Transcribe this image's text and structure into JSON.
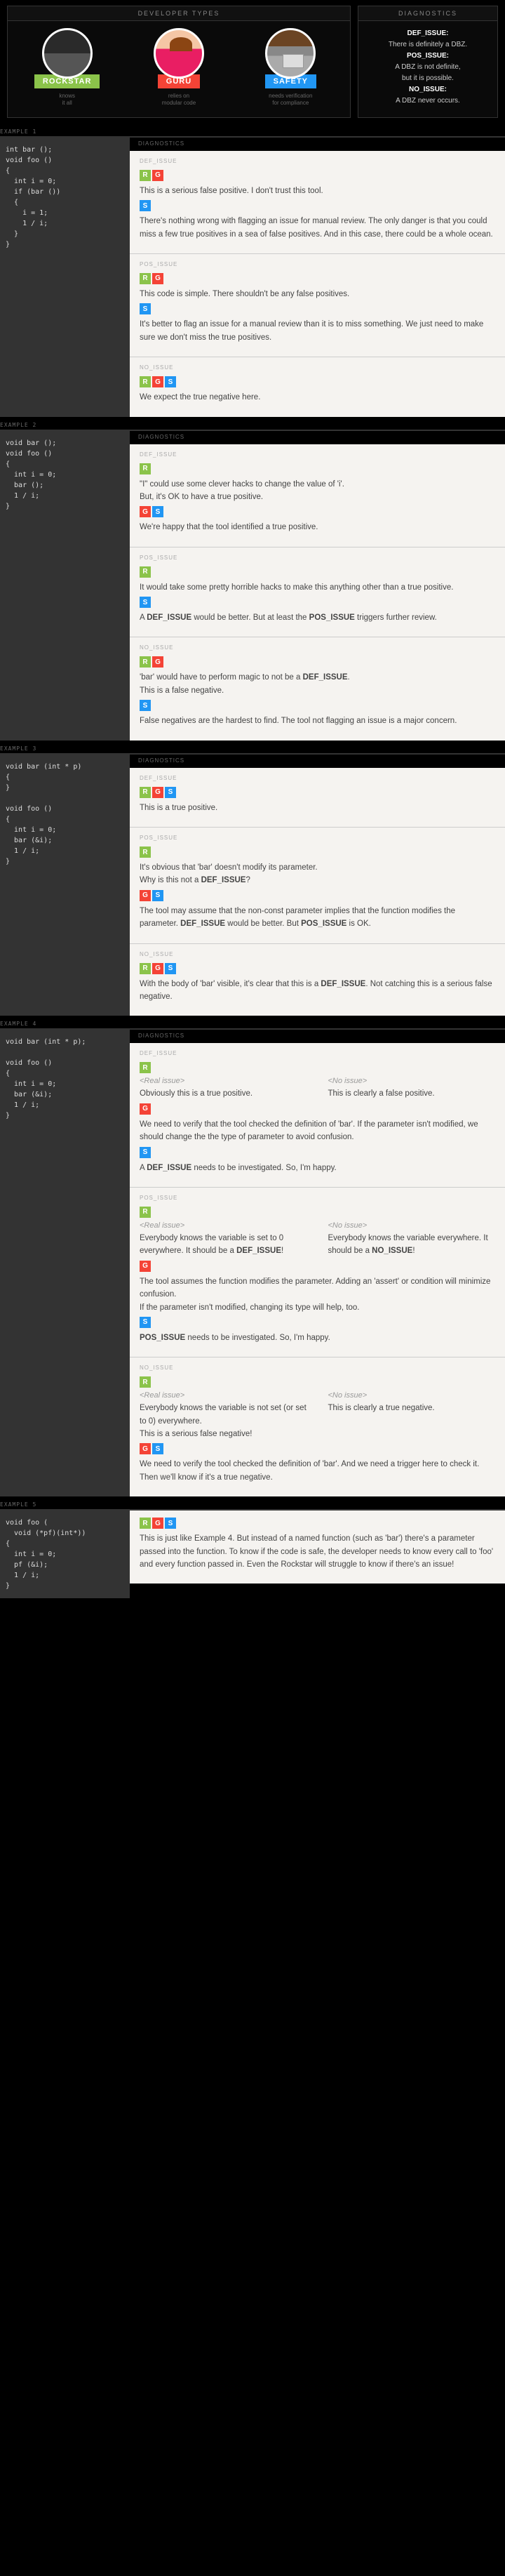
{
  "header": {
    "devtypes": "DEVELOPER TYPES",
    "diagnostics": "DIAGNOSTICS",
    "devs": {
      "rock": {
        "name": "ROCKSTAR",
        "sub": "knows\nit all"
      },
      "guru": {
        "name": "GURU",
        "sub": "relies on\nmodular code"
      },
      "safe": {
        "name": "SAFETY",
        "sub": "needs verification\nfor compliance"
      }
    },
    "defs": {
      "def_t": "DEF_ISSUE:",
      "def_d": "There is definitely a DBZ.",
      "pos_t": "POS_ISSUE:",
      "pos_d": "A DBZ is not definite,\nbut it is possible.",
      "no_t": "NO_ISSUE:",
      "no_d": "A DBZ never occurs."
    }
  },
  "ex1": {
    "label": "EXAMPLE 1",
    "code": "int bar ();\nvoid foo ()\n{\n  int i = 0;\n  if (bar ())\n  {\n    i = 1;\n    1 / i;\n  }\n}",
    "def": {
      "t": "DEF_ISSUE",
      "rg": "This is a serious false positive. I don't trust this tool.",
      "s": "There's nothing wrong with flagging an issue for manual review. The only danger is that you could miss a few true positives in a sea of false positives. And in this case, there could be a whole ocean."
    },
    "pos": {
      "t": "POS_ISSUE",
      "rg": "This code is simple. There shouldn't be any false positives.",
      "s": "It's better to flag an issue for a manual review than it is to miss something. We just need to make sure we don't miss the true positives."
    },
    "no": {
      "t": "NO_ISSUE",
      "all": "We expect the true negative here."
    }
  },
  "ex2": {
    "label": "EXAMPLE 2",
    "code": "void bar ();\nvoid foo ()\n{\n  int i = 0;\n  bar ();\n  1 / i;\n}",
    "def": {
      "t": "DEF_ISSUE",
      "r": "\"I\" could use some clever hacks to change the value of 'i'.\nBut, it's OK to have a true positive.",
      "gs": "We're happy that the tool identified a true positive."
    },
    "pos": {
      "t": "POS_ISSUE",
      "r": "It would take some pretty horrible hacks to make this anything other than a true positive.",
      "s": "A DEF_ISSUE would be better. But at least the POS_ISSUE triggers further review."
    },
    "no": {
      "t": "NO_ISSUE",
      "rg": "'bar' would have to perform magic to not be a DEF_ISSUE.\nThis is a false negative.",
      "s": "False negatives are the hardest to find. The tool not flagging an issue is a major concern."
    }
  },
  "ex3": {
    "label": "EXAMPLE 3",
    "code": "void bar (int * p)\n{\n}\n\nvoid foo ()\n{\n  int i = 0;\n  bar (&i);\n  1 / i;\n}",
    "def": {
      "t": "DEF_ISSUE",
      "all": "This is a true positive."
    },
    "pos": {
      "t": "POS_ISSUE",
      "r": "It's obvious that 'bar' doesn't modify its parameter.\nWhy is this not a DEF_ISSUE?",
      "gs": "The tool may assume that the non-const parameter implies that the function modifies the parameter. DEF_ISSUE would be better. But POS_ISSUE is OK."
    },
    "no": {
      "t": "NO_ISSUE",
      "all": "With the body of 'bar' visible, it's clear that this is a DEF_ISSUE.  Not catching this is a serious false negative."
    }
  },
  "ex4": {
    "label": "EXAMPLE 4",
    "code": "void bar (int * p);\n\nvoid foo ()\n{\n  int i = 0;\n  bar (&i);\n  1 / i;\n}",
    "def": {
      "t": "DEF_ISSUE",
      "real": "<Real issue>",
      "none": "<No issue>",
      "r_real": "Obviously this is a true positive.",
      "r_none": "This is clearly a false positive.",
      "g": "We need to verify that the tool checked the definition of 'bar'.  If the parameter isn't modified, we should change the the type of parameter to avoid confusion.",
      "s": "A DEF_ISSUE needs to be investigated. So, I'm happy."
    },
    "pos": {
      "t": "POS_ISSUE",
      "r_real": "Everybody knows the variable is set to 0 everywhere. It should be a DEF_ISSUE!",
      "r_none": "Everybody knows the variable everywhere. It should be a  NO_ISSUE!",
      "g": "The tool assumes the function modifies the parameter. Adding an 'assert' or condition will minimize confusion.\nIf the parameter isn't modified, changing its type will help, too.",
      "s": "POS_ISSUE needs to be investigated. So, I'm happy."
    },
    "no": {
      "t": "NO_ISSUE",
      "r_real": "Everybody knows the variable is not set (or set to 0) everywhere.\nThis is a serious false negative!",
      "r_none": "This is clearly a true negative.",
      "gs": "We need to verify the tool checked the definition of 'bar'. And we need a trigger here to check it. Then we'll know if it's a true negative."
    }
  },
  "ex5": {
    "label": "EXAMPLE 5",
    "code": "void foo (\n  void (*pf)(int*))\n{\n  int i = 0;\n  pf (&i);\n  1 / i;\n}",
    "text": "This is just like Example 4. But instead of a named function (such as 'bar') there's a parameter passed into the function. To know if the code is safe, the developer needs to know every call to 'foo' and every function passed in. Even the Rockstar will struggle to know if there's an issue!"
  }
}
